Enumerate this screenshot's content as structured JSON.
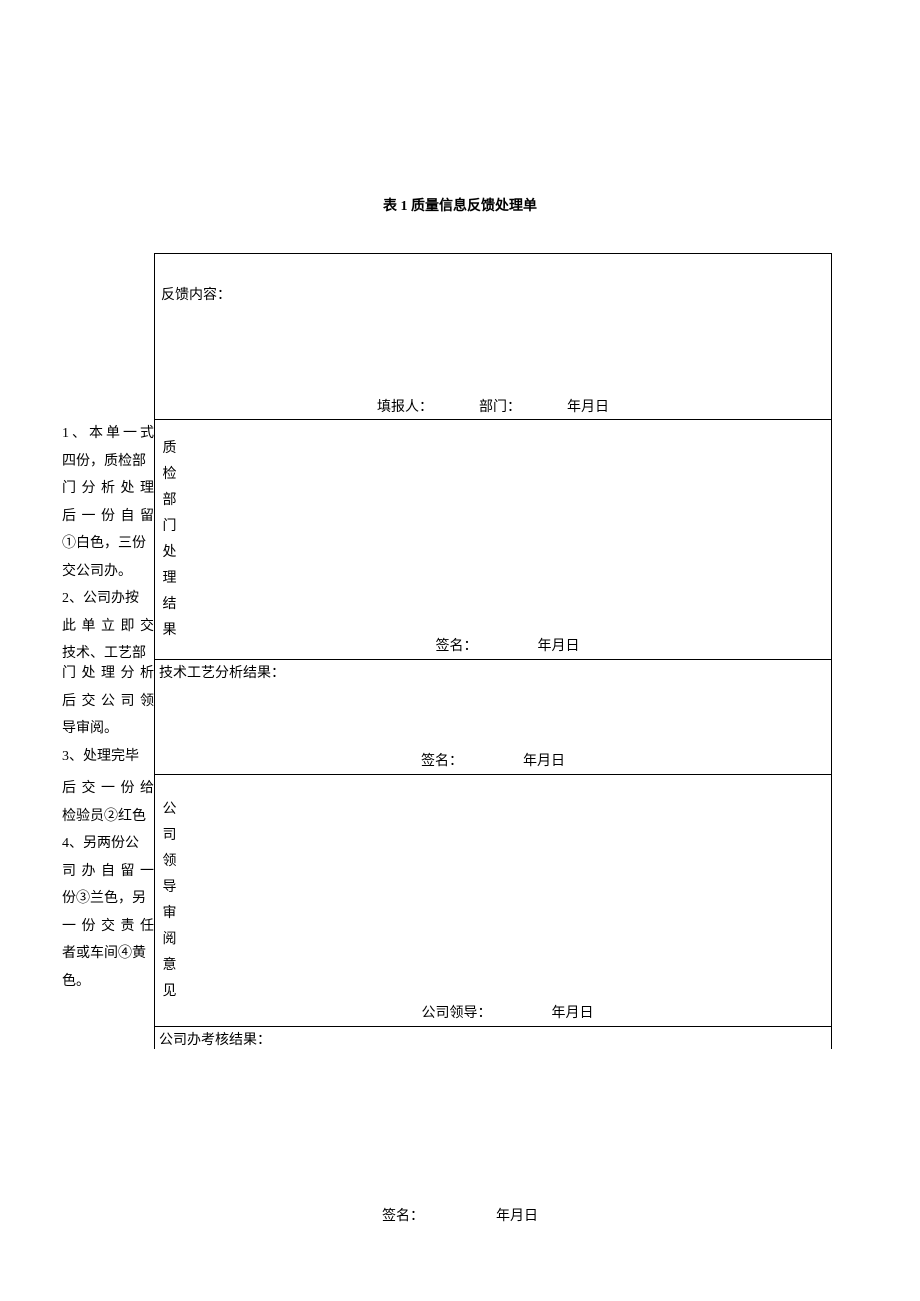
{
  "title": "表 1 质量信息反馈处理单",
  "feedback_label": "反馈内容：",
  "row1_sig": {
    "filler": "填报人：",
    "dept": "部门：",
    "date": "年月日"
  },
  "qc_label": "质检部门处理结果",
  "qc_sig": {
    "sign": "签名：",
    "date": "年月日"
  },
  "tech_label": "技术工艺分析结果：",
  "tech_sig": {
    "sign": "签名：",
    "date": "年月日"
  },
  "leader_label": "公司领导审阅意见",
  "leader_sig": {
    "sign": "公司领导：",
    "date": "年月日"
  },
  "office_label": "公司办考核结果：",
  "bottom_sig": {
    "sign": "签名：",
    "date": "年月日"
  },
  "notes": {
    "l1": "1、本单一式",
    "l2": "四份，质检部",
    "l3": "门分析处理",
    "l4": "后一份自留",
    "l5": "①白色，三份",
    "l6": "交公司办。",
    "l7": "2、公司办按",
    "l8": "此单立即交",
    "l9": "技术、工艺部",
    "l10": "门处理分析",
    "l11": "后交公司领",
    "l12": "导审阅。",
    "l13": "3、处理完毕",
    "l14": "后交一份给",
    "l15": "检验员②红色",
    "l16": "4、另两份公",
    "l17": "司办自留一",
    "l18": "份③兰色，另",
    "l19": "一份交责任",
    "l20": "者或车间④黄",
    "l21": "色。"
  }
}
